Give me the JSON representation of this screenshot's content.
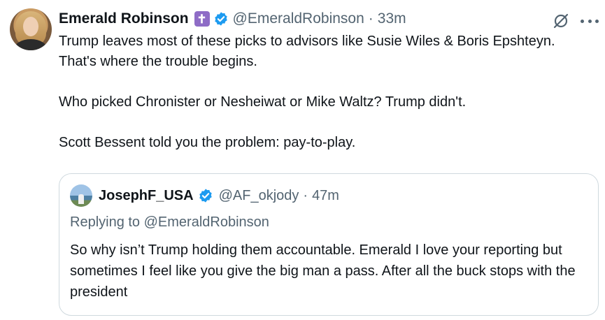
{
  "tweet": {
    "author_name": "Emerald Robinson",
    "badge_glyph": "✝",
    "handle": "@EmeraldRobinson",
    "separator": "·",
    "time": "33m",
    "paragraphs": [
      "Trump leaves most of these picks to advisors like Susie Wiles & Boris Epshteyn. That's where the trouble begins.",
      "Who picked Chronister or Nesheiwat or Mike Waltz? Trump didn't.",
      "Scott Bessent told you the problem: pay-to-play."
    ],
    "icons": {
      "badge": "cross-badge-icon",
      "verified": "verified-check-icon",
      "grok": "grok-icon",
      "more": "more-options-icon"
    }
  },
  "quoted_tweet": {
    "author_name": "JosephF_USA",
    "handle": "@AF_okjody",
    "separator": "·",
    "time": "47m",
    "replying_to": "Replying to @EmeraldRobinson",
    "text": "So why isn’t Trump holding them accountable. Emerald I love your reporting but sometimes I feel like you give the big man a pass. After all the buck stops with the president"
  },
  "colors": {
    "text_primary": "#0f1419",
    "text_secondary": "#536471",
    "verified_blue": "#1d9bf0",
    "badge_purple": "#8e6cc6",
    "border": "#cfd9de"
  }
}
